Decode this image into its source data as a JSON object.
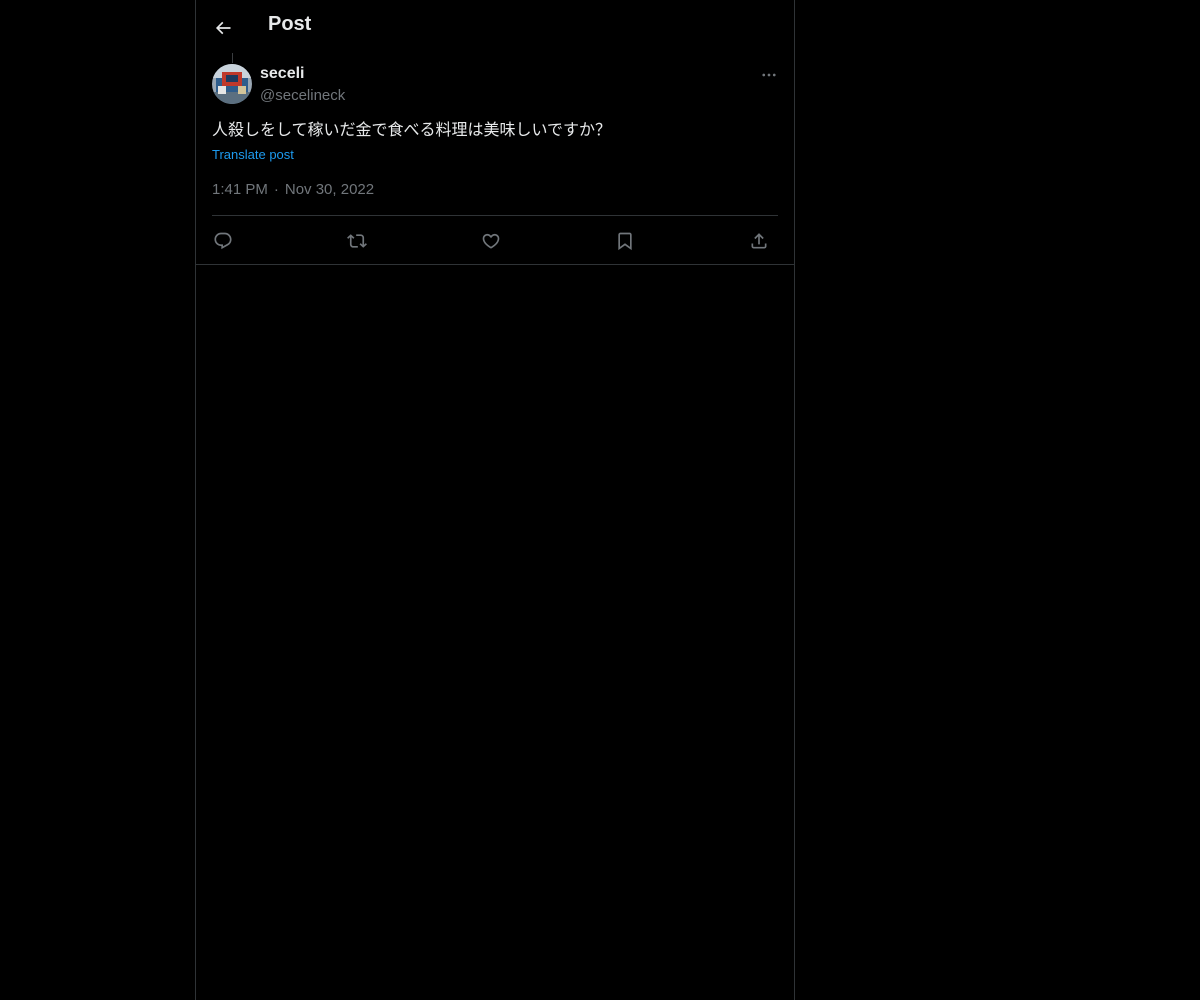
{
  "header": {
    "title": "Post",
    "back_icon": "arrow-left-icon"
  },
  "post": {
    "author": {
      "display_name": "seceli",
      "handle": "@secelineck",
      "avatar_icon": "avatar-photo"
    },
    "text": "人殺しをして稼いだ金で食べる料理は美味しいですか？",
    "translate_label": "Translate post",
    "time": "1:41 PM",
    "separator": "·",
    "date": "Nov 30, 2022",
    "more_icon": "more-horizontal-icon"
  },
  "actions": [
    {
      "name": "reply",
      "icon": "reply-icon"
    },
    {
      "name": "repost",
      "icon": "repost-icon"
    },
    {
      "name": "like",
      "icon": "heart-icon"
    },
    {
      "name": "bookmark",
      "icon": "bookmark-icon"
    },
    {
      "name": "share",
      "icon": "share-icon"
    }
  ],
  "colors": {
    "background": "#000000",
    "text": "#e7e9ea",
    "secondary": "#71767b",
    "link": "#1d9bf0",
    "border": "#2f3336"
  }
}
